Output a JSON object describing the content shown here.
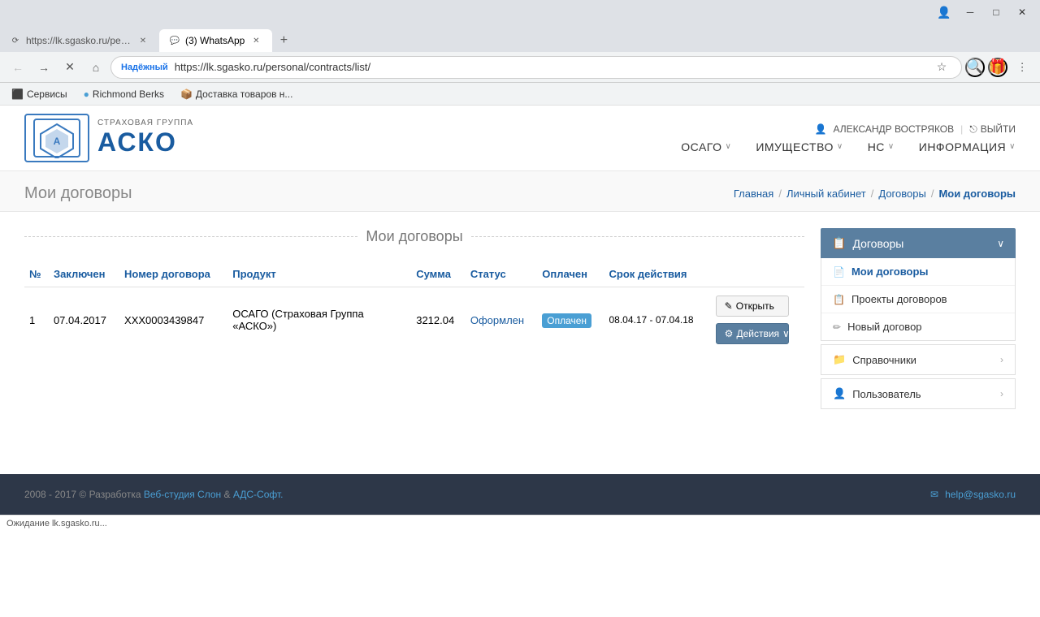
{
  "browser": {
    "tabs": [
      {
        "id": "tab1",
        "title": "https://lk.sgasko.ru/pers...",
        "active": false,
        "favicon": "⟳"
      },
      {
        "id": "tab2",
        "title": "(3) WhatsApp",
        "active": true,
        "favicon": "💬"
      }
    ],
    "new_tab_label": "+",
    "nav": {
      "back_label": "←",
      "forward_label": "→",
      "reload_label": "✕",
      "home_label": "⌂",
      "secure_label": "Надёжный",
      "url": "https://lk.sgasko.ru/personal/contracts/list/",
      "star_label": "☆",
      "menu_label": "⋮"
    },
    "bookmarks": [
      {
        "id": "bm1",
        "label": "Сервисы",
        "favicon": "⬛"
      },
      {
        "id": "bm2",
        "label": "Richmond Berks",
        "favicon": "🔵"
      },
      {
        "id": "bm3",
        "label": "Доставка товаров н...",
        "favicon": "📦"
      }
    ],
    "window_controls": {
      "minimize": "─",
      "maximize": "□",
      "close": "✕"
    }
  },
  "site": {
    "logo": {
      "subtitle": "страховая группа",
      "title": "АСКО"
    },
    "user": {
      "icon": "👤",
      "name": "АЛЕКСАНДР ВОСТРЯКОВ",
      "logout_label": "ВЫЙТИ",
      "logout_icon": "⎋"
    },
    "nav_items": [
      {
        "id": "osago",
        "label": "ОСАГО",
        "has_submenu": true
      },
      {
        "id": "property",
        "label": "ИМУЩЕСТВО",
        "has_submenu": true
      },
      {
        "id": "ns",
        "label": "НС",
        "has_submenu": true
      },
      {
        "id": "info",
        "label": "ИНФОРМАЦИЯ",
        "has_submenu": true
      }
    ]
  },
  "page": {
    "title": "Мои договоры",
    "breadcrumb": [
      {
        "id": "home",
        "label": "Главная",
        "link": true
      },
      {
        "id": "cabinet",
        "label": "Личный кабинет",
        "link": true
      },
      {
        "id": "contracts",
        "label": "Договоры",
        "link": true
      },
      {
        "id": "my_contracts",
        "label": "Мои договоры",
        "link": false
      }
    ],
    "section_title": "Мои договоры"
  },
  "table": {
    "columns": [
      {
        "id": "num",
        "label": "№"
      },
      {
        "id": "signed",
        "label": "Заключен"
      },
      {
        "id": "contract_num",
        "label": "Номер договора"
      },
      {
        "id": "product",
        "label": "Продукт"
      },
      {
        "id": "amount",
        "label": "Сумма"
      },
      {
        "id": "status",
        "label": "Статус"
      },
      {
        "id": "paid",
        "label": "Оплачен"
      },
      {
        "id": "validity",
        "label": "Срок действия"
      },
      {
        "id": "actions",
        "label": ""
      }
    ],
    "rows": [
      {
        "num": "1",
        "signed": "07.04.2017",
        "contract_num": "ХХХ0003439847",
        "product": "ОСАГО (Страховая Группа «АСКО»)",
        "amount": "3212.04",
        "status": "Оформлен",
        "paid": "Оплачен",
        "validity": "08.04.17 - 07.04.18",
        "btn_open": "✎ Открыть",
        "btn_actions": "⚙ Действия ∨"
      }
    ]
  },
  "sidebar": {
    "contracts_section": {
      "header": "Договоры",
      "icon": "📋",
      "chevron": "∨",
      "items": [
        {
          "id": "my_contracts",
          "label": "Мои договоры",
          "icon": "📄",
          "active": true
        },
        {
          "id": "draft_contracts",
          "label": "Проекты договоров",
          "icon": "📋",
          "active": false
        },
        {
          "id": "new_contract",
          "label": "Новый договор",
          "icon": "✏",
          "active": false
        }
      ]
    },
    "collapsible_sections": [
      {
        "id": "references",
        "label": "Справочники",
        "icon": "📁"
      },
      {
        "id": "user",
        "label": "Пользователь",
        "icon": "👤"
      }
    ]
  },
  "footer": {
    "copyright": "2008 - 2017 © Разработка",
    "studio_link": "Веб-студия Слон",
    "ampersand": "&",
    "ads_link": "АДС-Софт.",
    "email_icon": "✉",
    "email": "help@sgasko.ru"
  },
  "status_bar": {
    "text": "Ожидание lk.sgasko.ru..."
  }
}
